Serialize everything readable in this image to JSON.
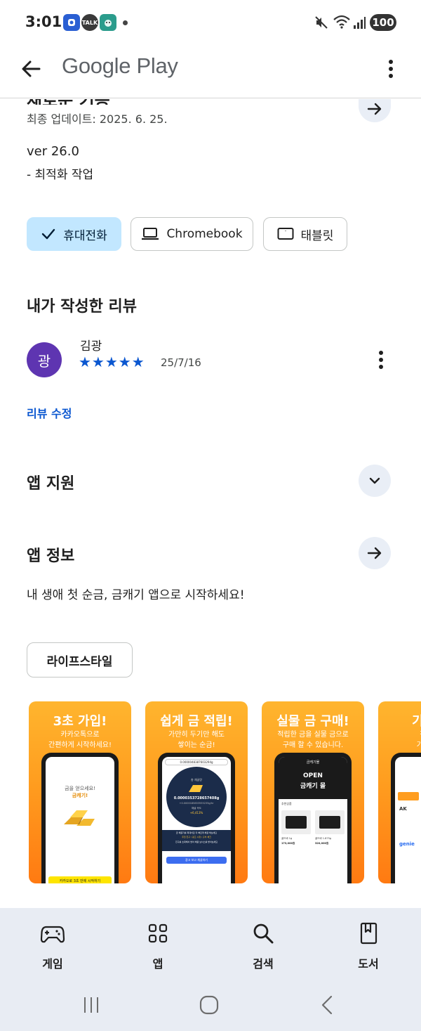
{
  "status_bar": {
    "time": "3:01",
    "talk_label": "TALK",
    "battery": "100"
  },
  "app_bar": {
    "title": "Google Play"
  },
  "whats_new": {
    "heading_partial": "새로운 기능",
    "last_updated": "최종 업데이트: 2025. 6. 25.",
    "version": "ver 26.0",
    "notes": "- 최적화 작업"
  },
  "device_chips": [
    {
      "label": "휴대전화",
      "icon": "check-icon",
      "selected": true
    },
    {
      "label": "Chromebook",
      "icon": "laptop-icon",
      "selected": false
    },
    {
      "label": "태블릿",
      "icon": "tablet-icon",
      "selected": false
    }
  ],
  "my_review": {
    "section_title": "내가 작성한 리뷰",
    "avatar_initial": "광",
    "reviewer_name": "김광",
    "rating": 5,
    "stars": "★★★★★",
    "date": "25/7/16",
    "edit_label": "리뷰 수정"
  },
  "app_support": {
    "title": "앱 지원"
  },
  "app_info": {
    "title": "앱 정보",
    "description": "내 생애 첫 순금, 금캐기 앱으로 시작하세요!",
    "category": "라이프스타일"
  },
  "screenshots": [
    {
      "title": "3초 가입!",
      "subtitle_1": "카카오톡으로",
      "subtitle_2": "간편하게 시작하세요!",
      "screen_text_1": "금을 얻으세요!",
      "screen_text_2": "금캐기!",
      "screen_button": "카카오로 3초 만에 시작하기"
    },
    {
      "title": "쉽게 금 적립!",
      "subtitle_1": "가만히 두기만 해도",
      "subtitle_2": "쌓이는 순금!",
      "screen_top": "0.0000048387603294g",
      "screen_circle_label": "총 채굴량",
      "screen_value": "0.0000353728657408g",
      "screen_value_sub": "+0.0000185853555235g/hr",
      "screen_rate_label": "채굴 속도",
      "screen_rate": "+6,413%",
      "screen_note": "금 채굴기를 최대치로 더 빠르게 채굴 해보세요",
      "screen_note_2": "추천 친구 / 광고 시청 / 출석 체크",
      "screen_note_3": "친구를 초대해서 받아 채굴 보너스를 받아보세요",
      "screen_button": "광고 보고 채굴하기"
    },
    {
      "title": "실물 금 구매!",
      "subtitle_1": "적립한 금을 실물 금으로",
      "subtitle_2": "구매 할 수 있습니다.",
      "screen_header": "금캐기몰",
      "screen_banner_1": "OPEN",
      "screen_banner_2": "금캐기 몰",
      "screen_section": "추천상품",
      "screen_item_1": "골드바 1g",
      "screen_item_2": "골드바 1.875g",
      "screen_price_1": "173,000원",
      "screen_price_2": "320,000원"
    },
    {
      "title": "기프티",
      "subtitle_1": "적립한",
      "subtitle_2": "기프티콘",
      "screen_logo_1": "AK",
      "screen_logo_2": "genie"
    }
  ],
  "bottom_nav": [
    {
      "label": "게임",
      "icon": "gamepad-icon"
    },
    {
      "label": "앱",
      "icon": "apps-grid-icon"
    },
    {
      "label": "검색",
      "icon": "search-icon"
    },
    {
      "label": "도서",
      "icon": "book-icon"
    }
  ]
}
